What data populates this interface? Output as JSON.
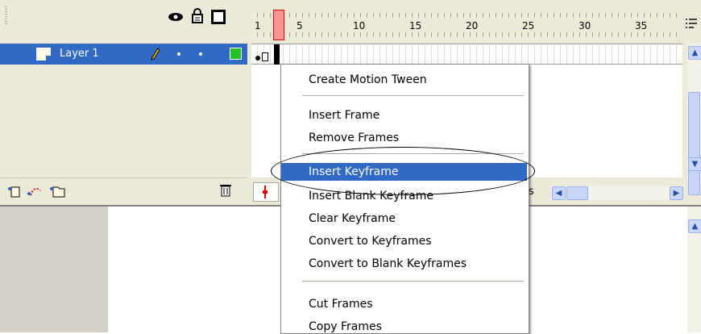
{
  "timeline": {
    "layer_header": {
      "eye_icon": "eye-icon",
      "lock_icon": "lock-icon",
      "outline_icon": "outline-square-icon"
    },
    "ruler": {
      "numbers": [
        "1",
        "5",
        "10",
        "15",
        "20",
        "25",
        "30",
        "35"
      ]
    },
    "layer": {
      "name": "Layer 1",
      "selected": true,
      "outline_color": "#22c322"
    },
    "bottom_toolbar": {
      "trash_icon": "trash-icon"
    },
    "partial_status_text": "s"
  },
  "context_menu": {
    "items": [
      {
        "label": "Create Motion Tween"
      },
      {
        "label": "Insert Frame"
      },
      {
        "label": "Remove Frames"
      },
      {
        "label": "Insert Keyframe",
        "highlighted": true
      },
      {
        "label": "Insert Blank Keyframe"
      },
      {
        "label": "Clear Keyframe"
      },
      {
        "label": "Convert to Keyframes"
      },
      {
        "label": "Convert to Blank Keyframes"
      },
      {
        "label": "Cut Frames"
      },
      {
        "label": "Copy Frames"
      }
    ]
  },
  "colors": {
    "selection": "#316ac5",
    "panel": "#ece9d8",
    "playhead": "#ff9494"
  }
}
